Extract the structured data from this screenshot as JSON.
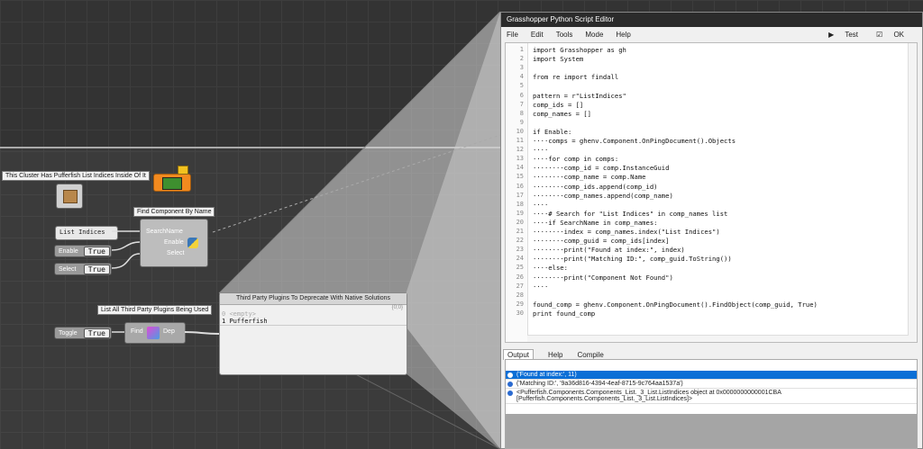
{
  "canvas": {
    "cluster_label": "This Cluster Has Pufferfish List Indices Inside Of It",
    "find_component": {
      "title": "Find Component By Name",
      "inputs": [
        "SearchName",
        "Enable",
        "Select"
      ]
    },
    "list_indices_panel": "List Indices",
    "enable_toggle": {
      "key": "Enable",
      "value": "True"
    },
    "select_toggle": {
      "key": "Select",
      "value": "True"
    },
    "plugins_label": "List All Third Party Plugins Being Used",
    "toggle": {
      "key": "Toggle",
      "value": "True"
    },
    "find_dep": {
      "left": "Find",
      "right": "Dep"
    },
    "panel": {
      "title": "Third Party Plugins To Deprecate With Native Solutions",
      "path": "{0;0}",
      "rows": [
        {
          "idx": "0",
          "text": "<empty>"
        },
        {
          "idx": "1",
          "text": "Pufferfish"
        }
      ]
    }
  },
  "editor": {
    "title": "Grasshopper Python Script Editor",
    "menu": [
      "File",
      "Edit",
      "Tools",
      "Mode",
      "Help"
    ],
    "test_label": "Test",
    "ok_label": "OK",
    "code_lines": [
      "import Grasshopper as gh",
      "import System",
      "",
      "from re import findall",
      "",
      "pattern = r\"ListIndices\"",
      "comp_ids = []",
      "comp_names = []",
      "",
      "if Enable:",
      "····comps = ghenv.Component.OnPingDocument().Objects",
      "····",
      "····for comp in comps:",
      "········comp_id = comp.InstanceGuid",
      "········comp_name = comp.Name",
      "········comp_ids.append(comp_id)",
      "········comp_names.append(comp_name)",
      "····",
      "····# Search for \"List Indices\" in comp_names list",
      "····if SearchName in comp_names:",
      "········index = comp_names.index(\"List Indices\")",
      "········comp_guid = comp_ids[index]",
      "········print(\"Found at index:\", index)",
      "········print(\"Matching ID:\", comp_guid.ToString())",
      "····else:",
      "········print(\"Component Not Found\")",
      "····",
      "",
      "found_comp = ghenv.Component.OnPingDocument().FindObject(comp_guid, True)",
      "print found_comp"
    ],
    "line_numbers": [
      "1",
      "2",
      "3",
      "4",
      "5",
      "6",
      "7",
      "8",
      "9",
      "10",
      "11",
      "12",
      "13",
      "14",
      "15",
      "16",
      "17",
      "18",
      "19",
      "20",
      "21",
      "22",
      "23",
      "24",
      "25",
      "26",
      "27",
      "28",
      "29",
      "30"
    ],
    "output_tabs": [
      "Output",
      "Help",
      "Compile"
    ],
    "output_rows": [
      "('Found at index:', 11)",
      "('Matching ID:', '9a36d816-4394-4eaf-8715-9c764aa1537a')",
      "<Pufferfish.Components.Components_List._3_List.ListIndices object at 0x0000000000001CBA",
      "[Pufferfish.Components.Components_List._3_List.ListIndices]>"
    ]
  },
  "colors": {
    "accent": "#0b6fd6",
    "canvas": "#3b3b3b",
    "titlebar": "#2b2b2b"
  }
}
